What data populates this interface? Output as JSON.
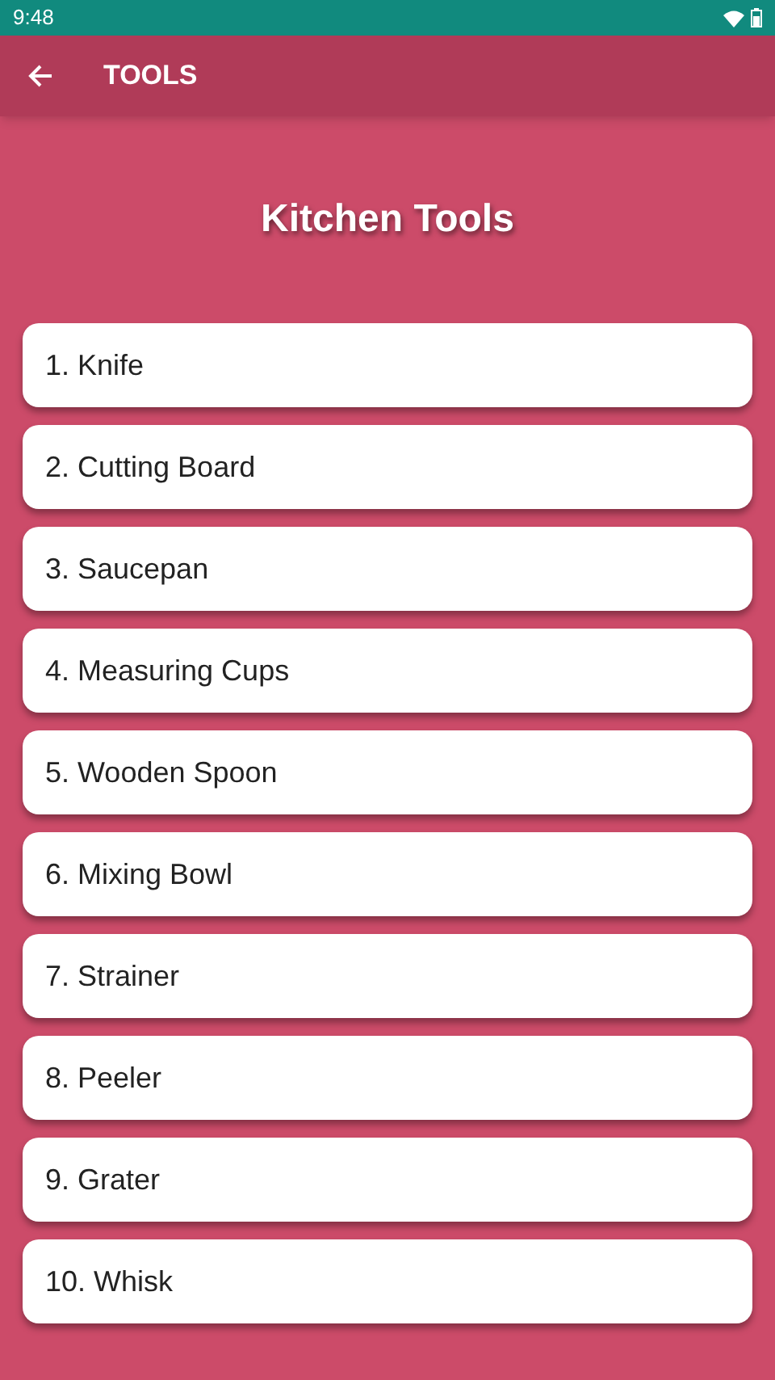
{
  "status_bar": {
    "time": "9:48"
  },
  "app_bar": {
    "title": "TOOLS"
  },
  "heading": "Kitchen Tools",
  "items": [
    {
      "label": "1. Knife"
    },
    {
      "label": "2. Cutting Board"
    },
    {
      "label": "3. Saucepan"
    },
    {
      "label": "4. Measuring Cups"
    },
    {
      "label": "5. Wooden Spoon"
    },
    {
      "label": "6. Mixing Bowl"
    },
    {
      "label": "7. Strainer"
    },
    {
      "label": "8. Peeler"
    },
    {
      "label": "9. Grater"
    },
    {
      "label": "10. Whisk"
    }
  ]
}
